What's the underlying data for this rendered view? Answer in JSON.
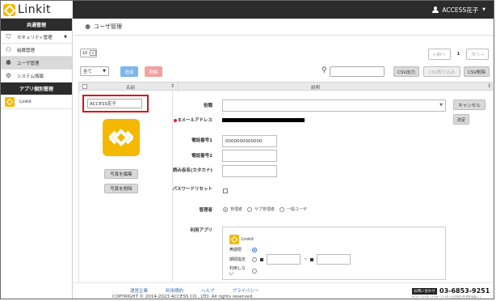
{
  "app": {
    "logo_text": "Linkit",
    "user_name": "ACCESS花子"
  },
  "sidebar": {
    "common_header": "共通管理",
    "security_select": "セキュリティ管理",
    "items": [
      {
        "label": "組織管理",
        "icon": "org-icon"
      },
      {
        "label": "ユーザ管理",
        "icon": "user-icon"
      },
      {
        "label": "システム情報",
        "icon": "system-icon"
      }
    ],
    "apps_header": "アプリ個別管理",
    "app_item": "Linkit"
  },
  "page": {
    "title": "ユーザ管理"
  },
  "list_controls": {
    "per_page": "10",
    "pager": {
      "prev": "←前へ",
      "current": "1",
      "next": "次へ→"
    },
    "filter_select": "全て",
    "add": "追加",
    "delete": "削除",
    "csv_out": "CSV出力",
    "csv_in": "CSV取り込み",
    "csv_delete": "CSV削除"
  },
  "table": {
    "col_name": "名前",
    "col_desc": "説明",
    "sort_icon": "⇕"
  },
  "detail": {
    "name_value": "ACCESS花子",
    "photo_edit": "写真を編集",
    "photo_delete": "写真を削除",
    "labels": {
      "role": "役職",
      "email": "Eメールアドレス",
      "phone1": "電話番号1",
      "phone2": "電話番号2",
      "kana": "読み仮名(カタカナ)",
      "pw_reset": "パスワードリセット",
      "admin": "管理者",
      "apps": "利用アプリ"
    },
    "phone1_value": "0000000000000",
    "admin_options": [
      "管理者",
      "サブ管理者",
      "一般ユーザ"
    ],
    "cancel": "キャンセル",
    "confirm": "決定",
    "app_box": {
      "name": "Linkit",
      "unlimited": "無期限",
      "period": "期間指定",
      "period_sep": "~",
      "not_use": "利用しない"
    }
  },
  "footer": {
    "links": [
      "運営企業",
      "利用規約",
      "ヘルプ",
      "プライバシー"
    ],
    "copyright": "COPYRIGHT © 2014-2023 ACCESS CO., LTD. All rights reserved.",
    "contact_tag": "お問い合わせ",
    "contact_number": "03-6853-9251",
    "contact_hours": "9:00~12:00 13:00~17:00 (土日祝日/年末年始除く)"
  },
  "colors": {
    "brand": "#f5b800",
    "header": "#2c2c2c",
    "add": "#7cb6ea",
    "delete": "#f2a0a0",
    "highlight": "#dd1111"
  }
}
